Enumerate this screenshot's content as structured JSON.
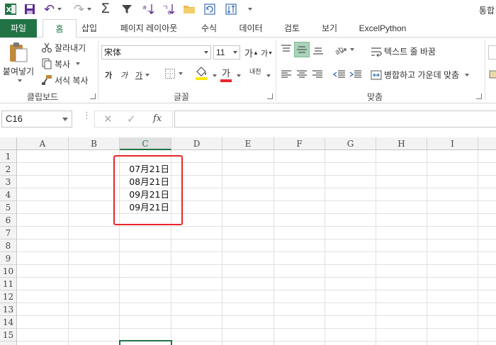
{
  "qat": {
    "undo_label": "↶",
    "redo_label": "↷",
    "sigma_label": "Σ",
    "window_title": "통합"
  },
  "tabs": [
    {
      "label": "파일"
    },
    {
      "label": "홈"
    },
    {
      "label": "삽입"
    },
    {
      "label": "페이지 레이아웃"
    },
    {
      "label": "수식"
    },
    {
      "label": "데이터"
    },
    {
      "label": "검토"
    },
    {
      "label": "보기"
    },
    {
      "label": "ExcelPython"
    }
  ],
  "clipboard": {
    "paste": "붙여넣기",
    "cut": "잘라내기",
    "copy": "복사",
    "format_painter": "서식 복사",
    "group_label": "클립보드"
  },
  "font": {
    "name": "宋体",
    "size": "11",
    "grow": "가",
    "shrink": "가",
    "bold": "가",
    "italic": "가",
    "underline": "가",
    "font_color_glyph": "가",
    "phonetic": "내천",
    "group_label": "글꼴"
  },
  "alignment": {
    "wrap_text": "텍스트 줄 바꿈",
    "merge_center": "병합하고 가운데 맞춤",
    "group_label": "맞춤"
  },
  "formula_bar": {
    "name_box": "C16",
    "cancel": "✕",
    "enter": "✓",
    "fx": "fx",
    "formula": ""
  },
  "grid": {
    "columns": [
      "A",
      "B",
      "C",
      "D",
      "E",
      "F",
      "G",
      "H",
      "I"
    ],
    "rows": [
      "1",
      "2",
      "3",
      "4",
      "5",
      "6",
      "7",
      "8",
      "9",
      "10",
      "11",
      "12",
      "13",
      "14",
      "15"
    ],
    "selected_column": "C",
    "cells": [
      {
        "ref": "C2",
        "value": "07月21日"
      },
      {
        "ref": "C3",
        "value": "08月21日"
      },
      {
        "ref": "C4",
        "value": "09月21日"
      },
      {
        "ref": "C5",
        "value": "09月21日"
      }
    ]
  },
  "colors": {
    "excel_green": "#217346",
    "highlight": "#e8262a"
  }
}
